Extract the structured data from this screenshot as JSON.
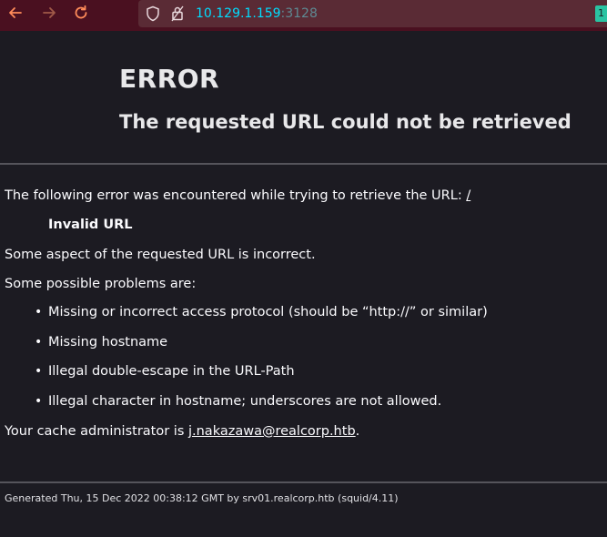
{
  "browser": {
    "url_host": "10.129.1.159",
    "url_port": ":3128",
    "badge_text": "1"
  },
  "page": {
    "heading": "ERROR",
    "subheading": "The requested URL could not be retrieved",
    "intro_text": "The following error was encountered while trying to retrieve the URL: ",
    "intro_link": "/",
    "error_title": "Invalid URL",
    "aspect_text": "Some aspect of the requested URL is incorrect.",
    "problems_intro": "Some possible problems are:",
    "problems": [
      "Missing or incorrect access protocol (should be “http://” or similar)",
      "Missing hostname",
      "Illegal double-escape in the URL-Path",
      "Illegal character in hostname; underscores are not allowed."
    ],
    "admin_prefix": "Your cache administrator is ",
    "admin_email": "j.nakazawa@realcorp.htb",
    "admin_suffix": ".",
    "footer": "Generated Thu, 15 Dec 2022 00:38:12 GMT by srv01.realcorp.htb (squid/4.11)"
  },
  "colors": {
    "toolbar_bg": "#4a1020",
    "urlbar_bg": "#5a2b35",
    "url_color": "#00ddff",
    "nav_icon_color": "#ff8c5a",
    "page_bg": "#1c1b22"
  },
  "icons": {
    "back": "back-arrow-icon",
    "forward": "forward-arrow-icon",
    "reload": "reload-icon",
    "shield": "shield-icon",
    "lock": "lock-icon"
  }
}
